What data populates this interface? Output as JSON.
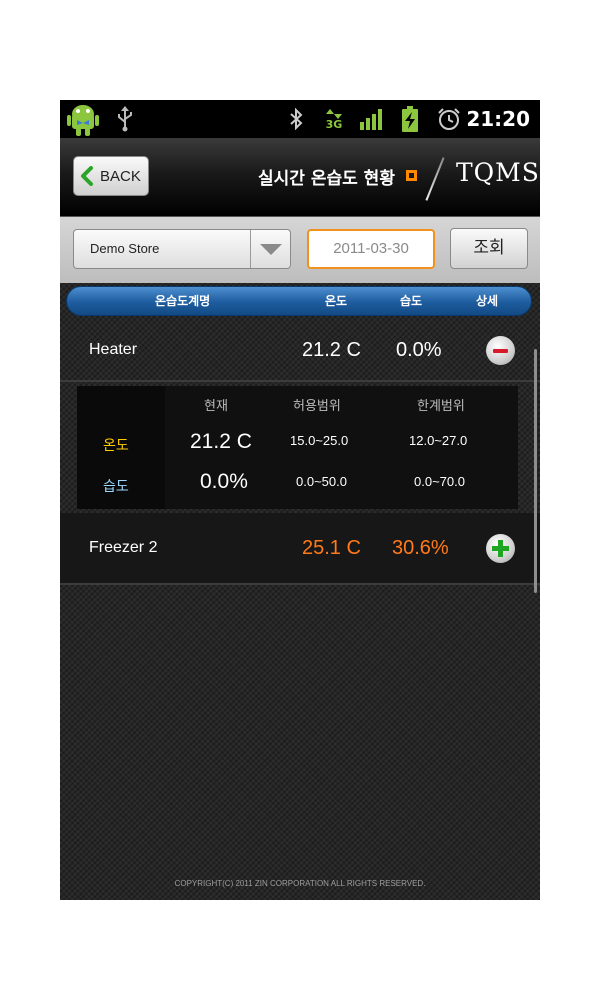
{
  "status_bar": {
    "time": "21:20",
    "icons": [
      "android-robot-icon",
      "usb-icon",
      "bluetooth-icon",
      "3g-icon",
      "signal-icon",
      "battery-icon",
      "alarm-icon"
    ],
    "network_label": "3G"
  },
  "header": {
    "back_label": "BACK",
    "title": "실시간 온습도 현황",
    "logo": "TQMS",
    "accent_color": "#ff8a00"
  },
  "filter": {
    "store": "Demo Store",
    "date": "2011-03-30",
    "search_label": "조회"
  },
  "table": {
    "columns": [
      "온습도계명",
      "온도",
      "습도",
      "상세"
    ],
    "header_color": "#1d5c9e"
  },
  "devices": [
    {
      "name": "Heater",
      "temp": "21.2 C",
      "humidity": "0.0%",
      "expanded": true,
      "value_color": "#ffffff"
    },
    {
      "name": "Freezer 2",
      "temp": "25.1 C",
      "humidity": "30.6%",
      "expanded": false,
      "value_color": "#ff7a1a"
    }
  ],
  "detail": {
    "headers": [
      "현재",
      "허용범위",
      "한계범위"
    ],
    "rows": [
      {
        "label": "온도",
        "current": "21.2 C",
        "allowed": "15.0~25.0",
        "limit": "12.0~27.0",
        "label_color": "#ffcc00"
      },
      {
        "label": "습도",
        "current": "0.0%",
        "allowed": "0.0~50.0",
        "limit": "0.0~70.0",
        "label_color": "#9fd8ff"
      }
    ]
  },
  "footer": {
    "copyright": "COPYRIGHT(C) 2011 ZIN CORPORATION ALL RIGHTS RESERVED."
  }
}
